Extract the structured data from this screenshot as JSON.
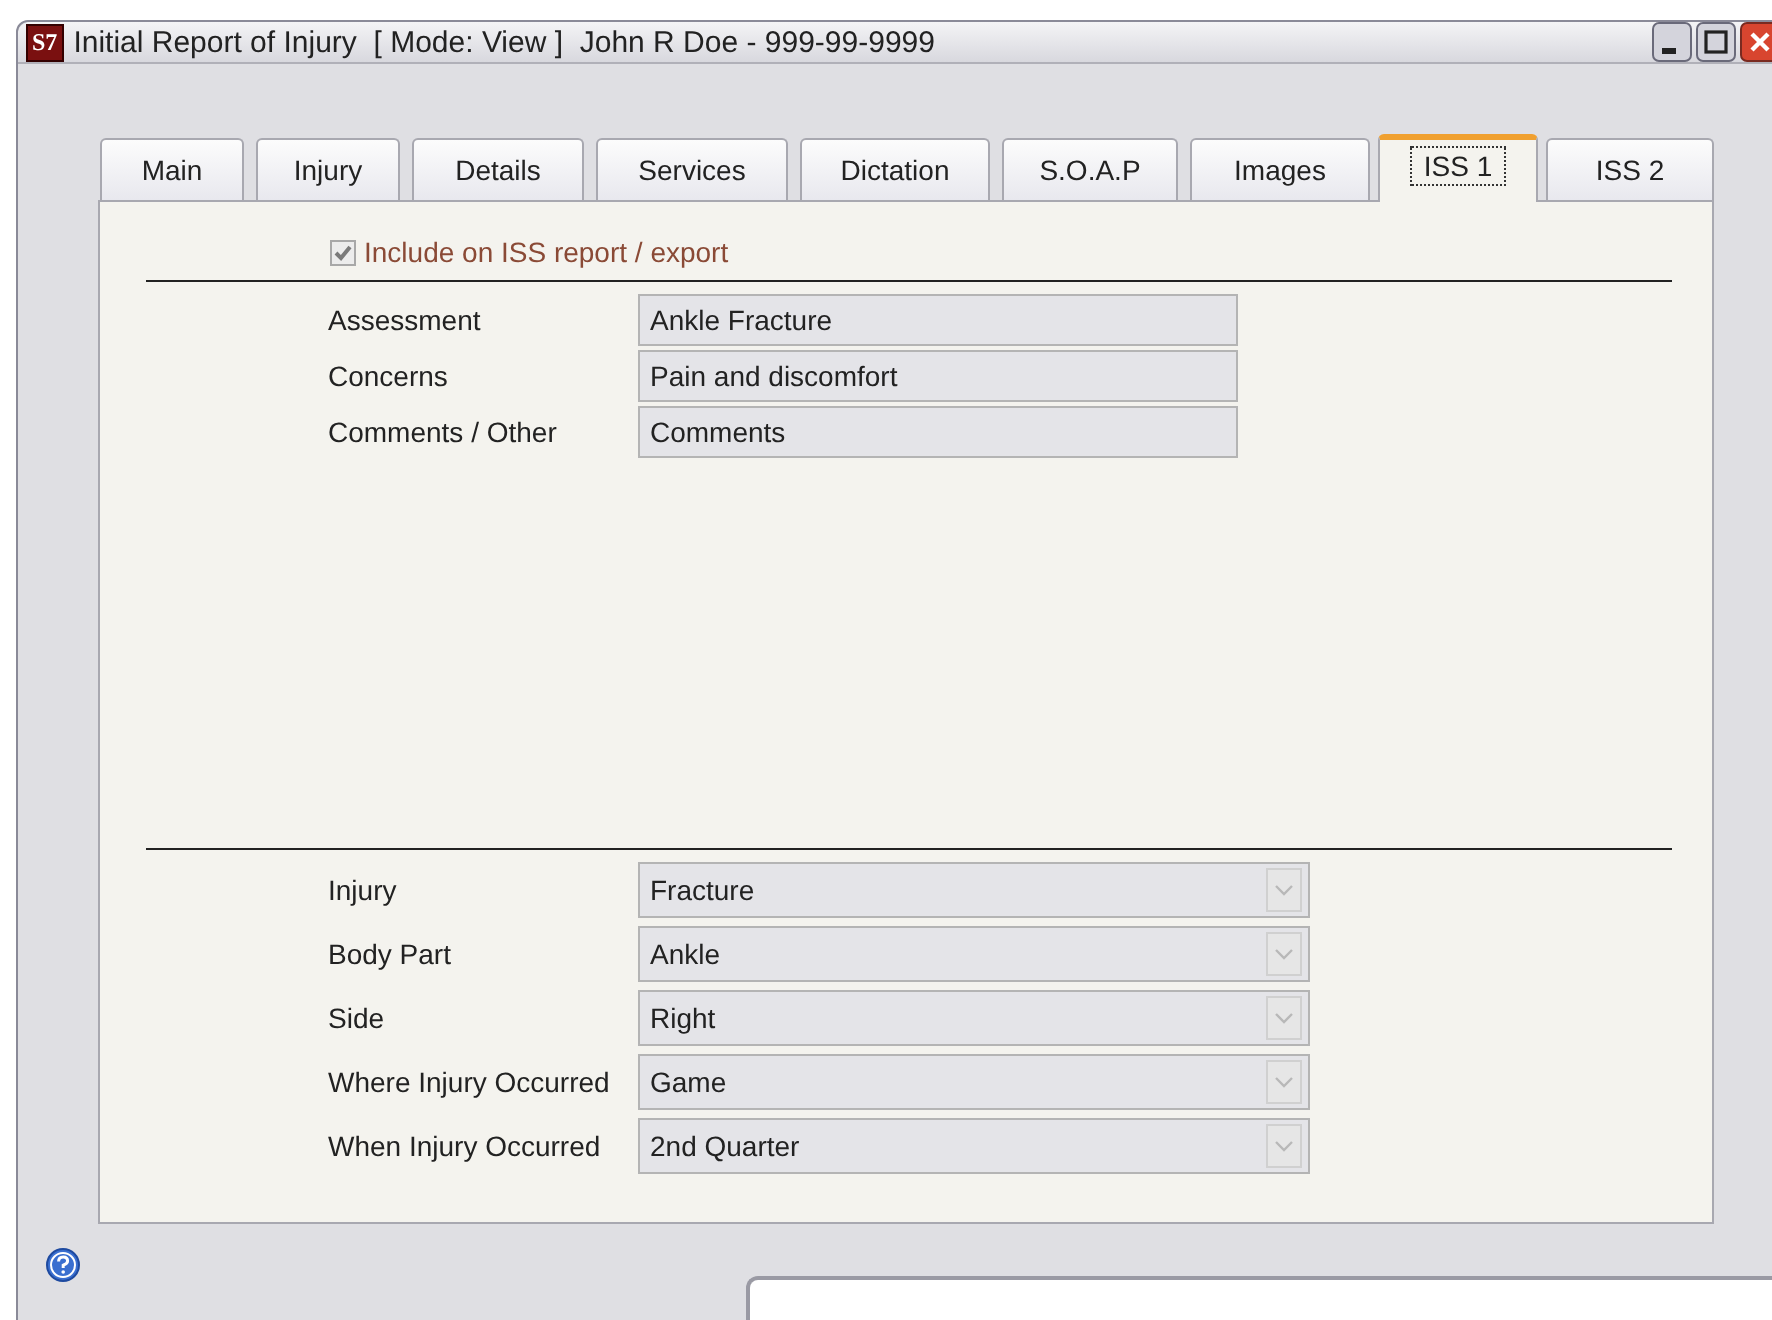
{
  "window": {
    "logo": "S7",
    "title": "Initial Report of Injury  [ Mode: View ]  John R Doe - 999-99-9999"
  },
  "tabs": [
    {
      "label": "Main",
      "selected": false
    },
    {
      "label": "Injury",
      "selected": false
    },
    {
      "label": "Details",
      "selected": false
    },
    {
      "label": "Services",
      "selected": false
    },
    {
      "label": "Dictation",
      "selected": false
    },
    {
      "label": "S.O.A.P",
      "selected": false
    },
    {
      "label": "Images",
      "selected": false
    },
    {
      "label": "ISS 1",
      "selected": true
    },
    {
      "label": "ISS 2",
      "selected": false
    }
  ],
  "include_checkbox": {
    "label": "Include on ISS report / export",
    "checked": true,
    "disabled": true
  },
  "text_fields": [
    {
      "label": "Assessment",
      "value": "Ankle Fracture"
    },
    {
      "label": "Concerns",
      "value": "Pain and discomfort"
    },
    {
      "label": "Comments / Other",
      "value": "Comments"
    }
  ],
  "dropdowns": [
    {
      "label": "Injury",
      "value": "Fracture"
    },
    {
      "label": "Body Part",
      "value": "Ankle"
    },
    {
      "label": "Side",
      "value": "Right"
    },
    {
      "label": "Where Injury Occurred",
      "value": "Game"
    },
    {
      "label": "When Injury Occurred",
      "value": "2nd Quarter"
    }
  ]
}
